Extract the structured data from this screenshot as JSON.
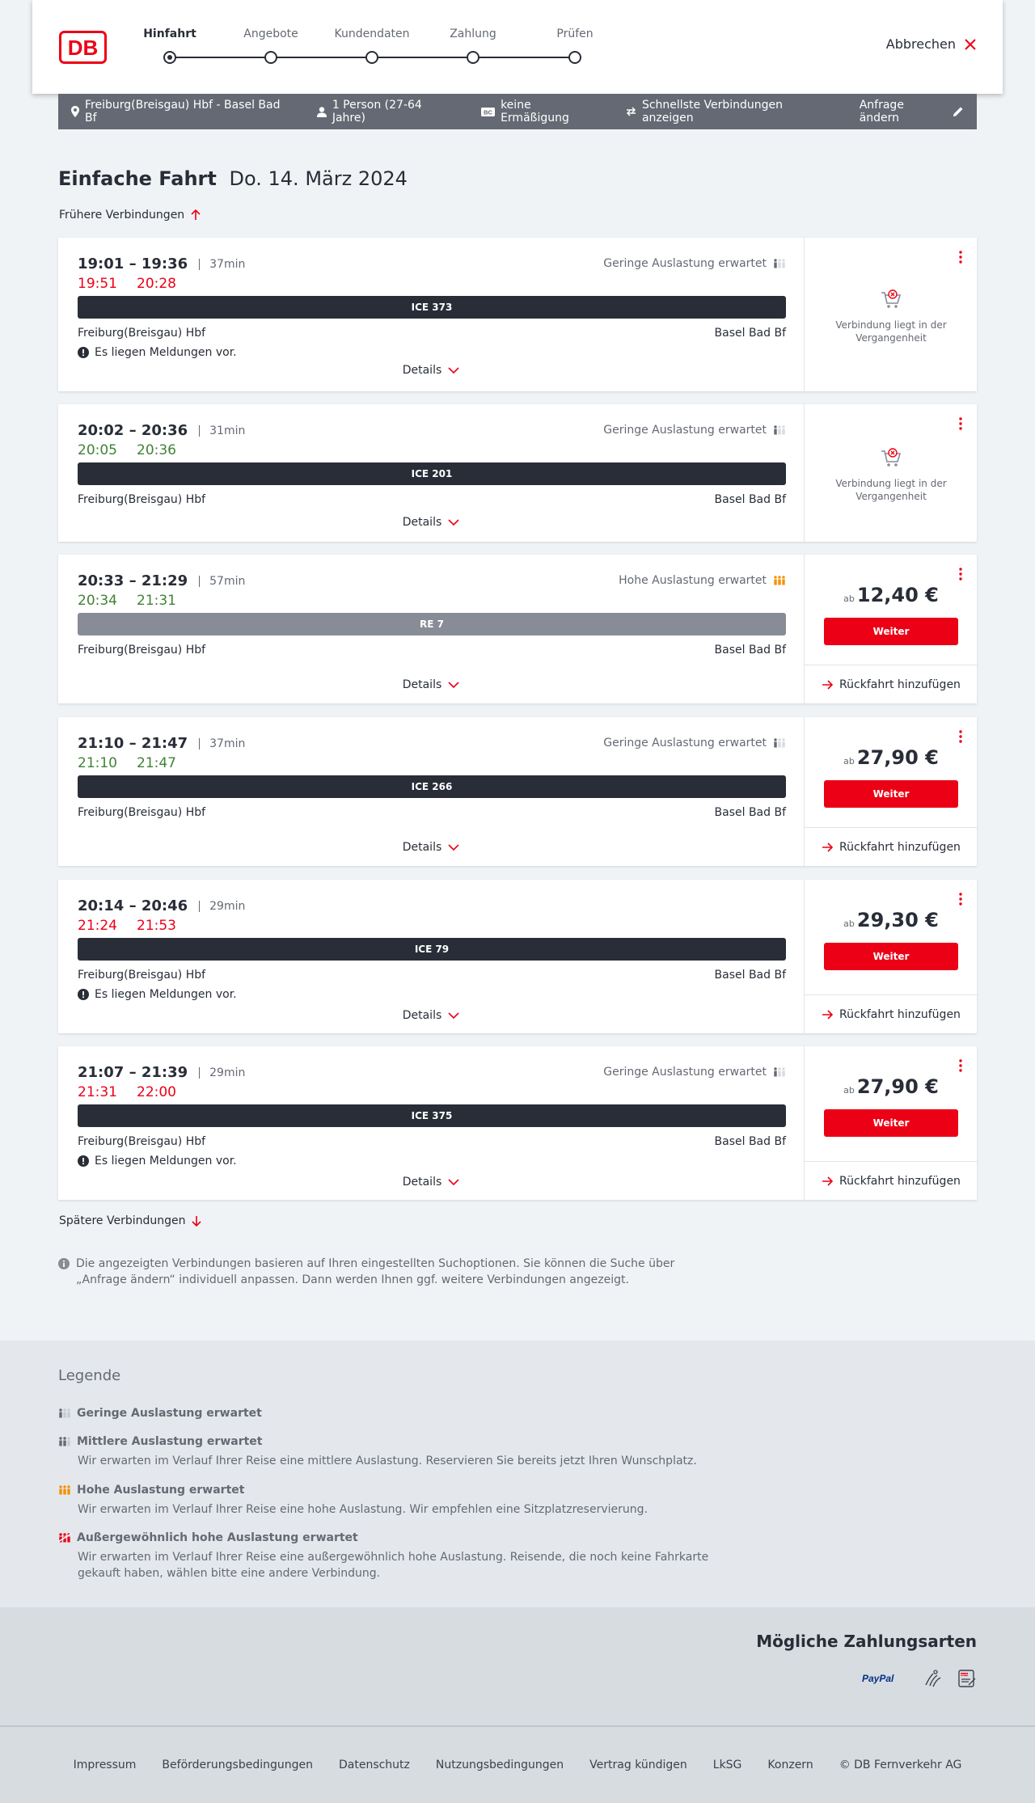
{
  "header": {
    "logo_text": "DB",
    "steps": [
      "Hinfahrt",
      "Angebote",
      "Kundendaten",
      "Zahlung",
      "Prüfen"
    ],
    "cancel_label": "Abbrechen"
  },
  "summary": {
    "route": "Freiburg(Breisgau) Hbf - Basel Bad Bf",
    "persons": "1 Person (27-64 Jahre)",
    "discount_badge": "BC",
    "discount": "keine Ermäßigung",
    "fastest": "Schnellste Verbindungen anzeigen",
    "change": "Anfrage ändern"
  },
  "title": {
    "type": "Einfache Fahrt",
    "date": "Do. 14. März 2024"
  },
  "earlier": "Frühere Verbindungen",
  "later": "Spätere Verbindungen",
  "connections": [
    {
      "times": "19:01 – 19:36",
      "duration": "37min",
      "rt_dep": "19:51",
      "rt_arr": "20:28",
      "load": "Geringe Auslastung erwartet",
      "train": "ICE 373",
      "from": "Freiburg(Breisgau) Hbf",
      "to": "Basel Bad Bf",
      "message": "Es liegen Meldungen vor.",
      "details": "Details",
      "past": "Verbindung liegt in der Vergangenheit"
    },
    {
      "times": "20:02 – 20:36",
      "duration": "31min",
      "rt_dep": "20:05",
      "rt_arr": "20:36",
      "load": "Geringe Auslastung erwartet",
      "train": "ICE 201",
      "from": "Freiburg(Breisgau) Hbf",
      "to": "Basel Bad Bf",
      "details": "Details",
      "past": "Verbindung liegt in der Vergangenheit"
    },
    {
      "times": "20:33 – 21:29",
      "duration": "57min",
      "rt_dep": "20:34",
      "rt_arr": "21:31",
      "load": "Hohe Auslastung erwartet",
      "train": "RE 7",
      "from": "Freiburg(Breisgau) Hbf",
      "to": "Basel Bad Bf",
      "details": "Details",
      "price_prefix": "ab",
      "price": "12,40 €",
      "button": "Weiter",
      "return": "Rückfahrt hinzufügen"
    },
    {
      "times": "21:10 – 21:47",
      "duration": "37min",
      "rt_dep": "21:10",
      "rt_arr": "21:47",
      "load": "Geringe Auslastung erwartet",
      "train": "ICE 266",
      "from": "Freiburg(Breisgau) Hbf",
      "to": "Basel Bad Bf",
      "details": "Details",
      "price_prefix": "ab",
      "price": "27,90 €",
      "button": "Weiter",
      "return": "Rückfahrt hinzufügen"
    },
    {
      "times": "20:14 – 20:46",
      "duration": "29min",
      "rt_dep": "21:24",
      "rt_arr": "21:53",
      "train": "ICE 79",
      "from": "Freiburg(Breisgau) Hbf",
      "to": "Basel Bad Bf",
      "message": "Es liegen Meldungen vor.",
      "details": "Details",
      "price_prefix": "ab",
      "price": "29,30 €",
      "button": "Weiter",
      "return": "Rückfahrt hinzufügen"
    },
    {
      "times": "21:07 – 21:39",
      "duration": "29min",
      "rt_dep": "21:31",
      "rt_arr": "22:00",
      "load": "Geringe Auslastung erwartet",
      "train": "ICE 375",
      "from": "Freiburg(Breisgau) Hbf",
      "to": "Basel Bad Bf",
      "message": "Es liegen Meldungen vor.",
      "details": "Details",
      "price_prefix": "ab",
      "price": "27,90 €",
      "button": "Weiter",
      "return": "Rückfahrt hinzufügen"
    }
  ],
  "info_text": "Die angezeigten Verbindungen basieren auf Ihren eingestellten Suchoptionen. Sie können die Suche über „Anfrage ändern“ individuell anpassen. Dann werden Ihnen ggf. weitere Verbindungen angezeigt.",
  "legend": {
    "title": "Legende",
    "items": [
      {
        "head": "Geringe Auslastung erwartet",
        "desc": ""
      },
      {
        "head": "Mittlere Auslastung erwartet",
        "desc": "Wir erwarten im Verlauf Ihrer Reise eine mittlere Auslastung. Reservieren Sie bereits jetzt Ihren Wunschplatz."
      },
      {
        "head": "Hohe Auslastung erwartet",
        "desc": "Wir erwarten im Verlauf Ihrer Reise eine hohe Auslastung. Wir empfehlen eine Sitzplatzreservierung."
      },
      {
        "head": "Außergewöhnlich hohe Auslastung erwartet",
        "desc": "Wir erwarten im Verlauf Ihrer Reise eine außergewöhnlich hohe Auslastung. Reisende, die noch keine Fahrkarte gekauft haben, wählen bitte eine andere Verbindung."
      }
    ]
  },
  "payment": {
    "title": "Mögliche Zahlungsarten",
    "paypal": "PayPal",
    "sepa_label": "SEPA"
  },
  "footer": [
    "Impressum",
    "Beförderungsbedingungen",
    "Datenschutz",
    "Nutzungsbedingungen",
    "Vertrag kündigen",
    "LkSG",
    "Konzern",
    "© DB Fernverkehr AG"
  ],
  "colors": {
    "db_red": "#ec0016",
    "dark": "#282d37",
    "realtime_green": "#408335",
    "high_load": "#f39200"
  }
}
